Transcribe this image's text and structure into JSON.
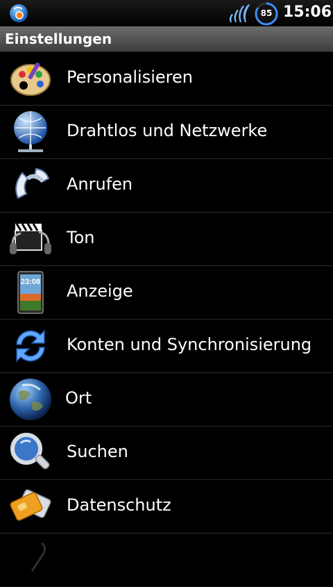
{
  "status_bar": {
    "battery": "85",
    "time": "15:06"
  },
  "title_bar": {
    "title": "Einstellungen"
  },
  "settings": [
    {
      "label": "Personalisieren",
      "icon": "palette-icon"
    },
    {
      "label": "Drahtlos und Netzwerke",
      "icon": "network-globe-icon"
    },
    {
      "label": "Anrufen",
      "icon": "phone-handset-icon"
    },
    {
      "label": "Ton",
      "icon": "clapperboard-headphones-icon"
    },
    {
      "label": "Anzeige",
      "icon": "display-phone-icon"
    },
    {
      "label": "Konten und Synchronisierung",
      "icon": "sync-icon"
    },
    {
      "label": "Ort",
      "icon": "earth-icon"
    },
    {
      "label": "Suchen",
      "icon": "magnifier-icon"
    },
    {
      "label": "Datenschutz",
      "icon": "cards-icon"
    }
  ]
}
